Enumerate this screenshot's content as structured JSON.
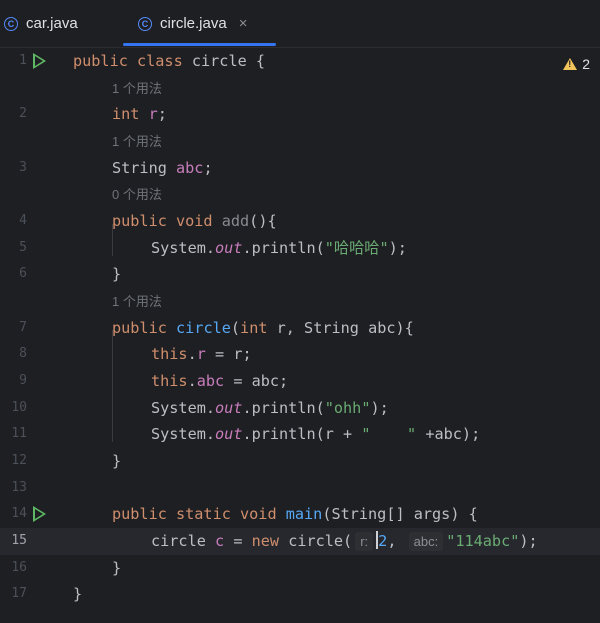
{
  "tabs": [
    {
      "label": "car.java",
      "icon": "C"
    },
    {
      "label": "circle.java",
      "icon": "C",
      "close": "×",
      "active": true
    }
  ],
  "warnings": {
    "count": "2"
  },
  "hints": {
    "usage1": "1 个用法",
    "usage2": "1 个用法",
    "usage0": "0 个用法",
    "usage3": "1 个用法"
  },
  "line_numbers": [
    "1",
    "2",
    "3",
    "4",
    "5",
    "6",
    "7",
    "8",
    "9",
    "10",
    "11",
    "12",
    "13",
    "14",
    "15",
    "16",
    "17"
  ],
  "code": {
    "l1_kw": "public class ",
    "l1_name": "circle",
    "l1_rest": " {",
    "l2_kw": "int ",
    "l2_fld": "r",
    "l2_rest": ";",
    "l3_type": "String ",
    "l3_fld": "abc",
    "l3_rest": ";",
    "l4_kw": "public void ",
    "l4_name": "add",
    "l4_rest": "(){",
    "l5_a": "System.",
    "l5_out": "out",
    "l5_b": ".println(",
    "l5_str": "\"哈哈哈\"",
    "l5_c": ");",
    "l6": "}",
    "l7_kw": "public ",
    "l7_name": "circle",
    "l7_a": "(",
    "l7_kw2": "int",
    "l7_b": " r, String abc){",
    "l8_kw": "this",
    "l8_a": ".",
    "l8_fld": "r",
    "l8_b": " = r;",
    "l9_kw": "this",
    "l9_a": ".",
    "l9_fld": "abc",
    "l9_b": " = abc;",
    "l10_a": "System.",
    "l10_out": "out",
    "l10_b": ".println(",
    "l10_str": "\"ohh\"",
    "l10_c": ");",
    "l11_a": "System.",
    "l11_out": "out",
    "l11_b": ".println(r + ",
    "l11_str": "\"    \"",
    "l11_c": " +abc);",
    "l12": "}",
    "l14_kw": "public static void ",
    "l14_name": "main",
    "l14_rest": "(String[] args) {",
    "l15_a": "circle ",
    "l15_var": "c",
    "l15_b": " = ",
    "l15_kw": "new",
    "l15_c": " circle(",
    "l15_hint1": "r:",
    "l15_num": "2",
    "l15_d": ",",
    "l15_hint2": "abc:",
    "l15_str": "\"114abc\"",
    "l15_e": ");",
    "l16": "}",
    "l17": "}"
  },
  "colors": {
    "background": "#1e1f22",
    "keyword": "#cf8e6d",
    "field": "#c77dbb",
    "function": "#56a8f5",
    "string": "#6aab73",
    "run": "#5fb865",
    "warning": "#f2c55c"
  }
}
